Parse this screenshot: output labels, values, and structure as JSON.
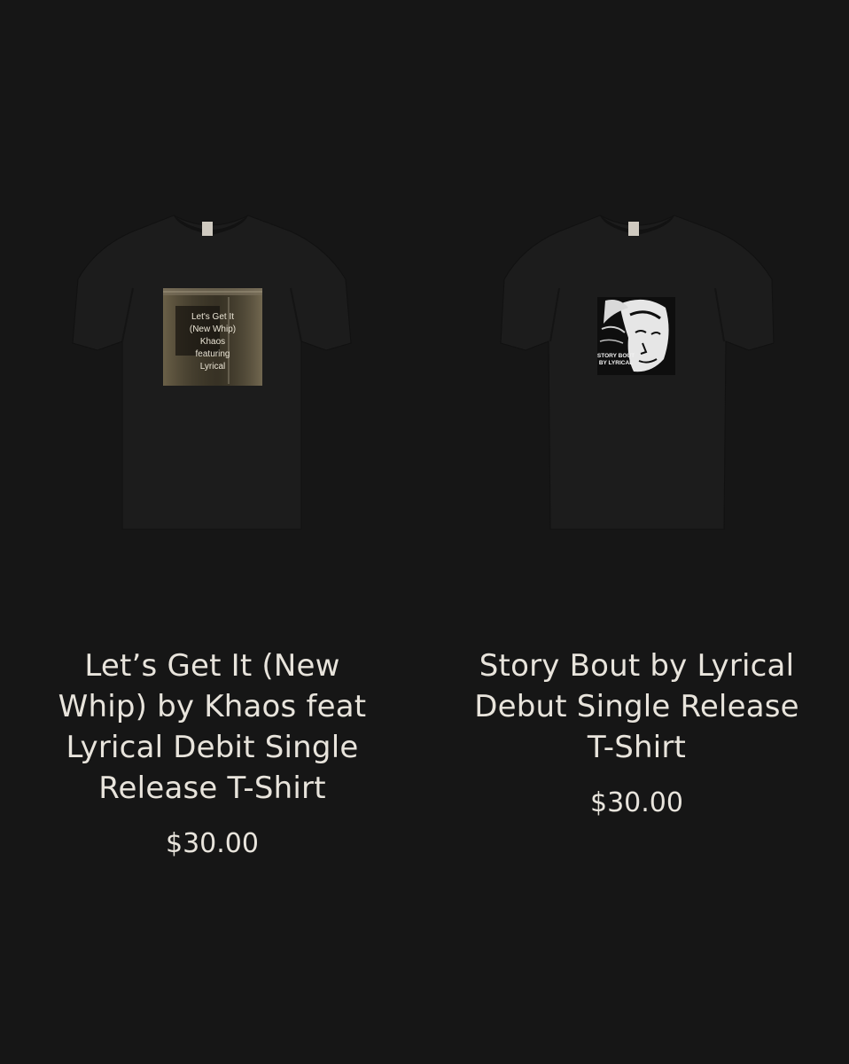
{
  "products": [
    {
      "title_lines": [
        "Let’s Get It (New",
        "Whip) by Khaos feat",
        "Lyrical Debit Single",
        "Release T-Shirt"
      ],
      "price": "$30.00",
      "artwork_text": [
        "Let's Get It",
        "(New Whip)",
        "Khaos",
        "featuring",
        "Lyrical"
      ],
      "shirt_color": "#1b1b1b"
    },
    {
      "title_lines": [
        "Story Bout by Lyrical",
        "Debut Single Release",
        "T-Shirt"
      ],
      "price": "$30.00",
      "artwork_text": [
        "STORY BOUT",
        "BY LYRICAL"
      ],
      "shirt_color": "#1b1b1b"
    }
  ],
  "colors": {
    "background": "#161616",
    "text": "#e8e4dc"
  }
}
